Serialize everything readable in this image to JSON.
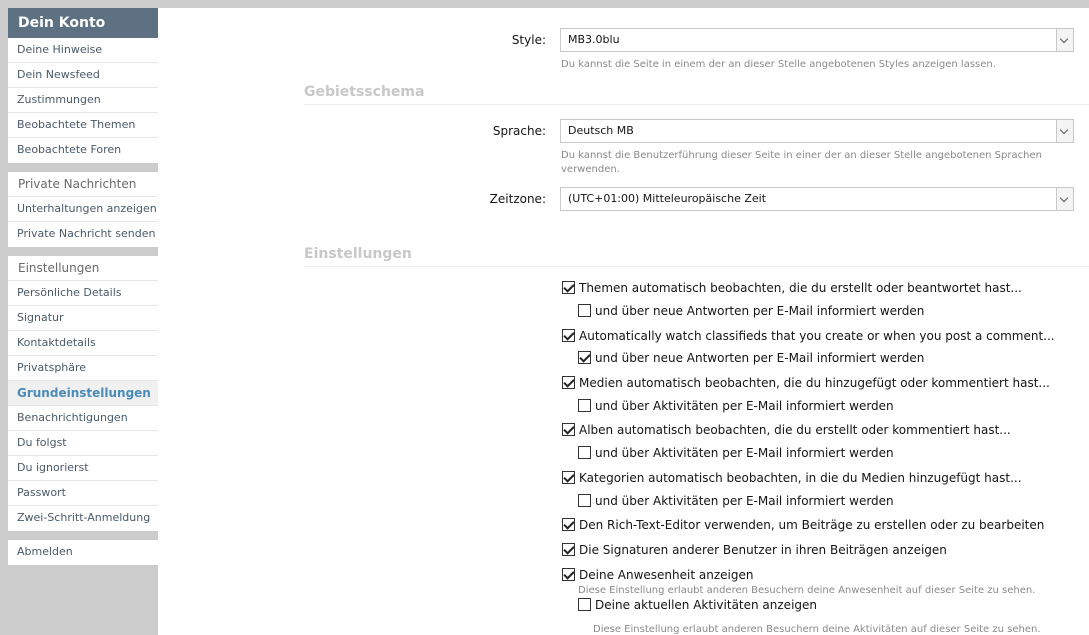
{
  "sidebar": {
    "title": "Dein Konto",
    "account_items": [
      "Deine Hinweise",
      "Dein Newsfeed",
      "Zustimmungen",
      "Beobachtete Themen",
      "Beobachtete Foren"
    ],
    "pm_section": "Private Nachrichten",
    "pm_items": [
      "Unterhaltungen anzeigen",
      "Private Nachricht senden"
    ],
    "settings_section": "Einstellungen",
    "settings_items": [
      "Persönliche Details",
      "Signatur",
      "Kontaktdetails",
      "Privatsphäre",
      "Grundeinstellungen",
      "Benachrichtigungen",
      "Du folgst",
      "Du ignorierst",
      "Passwort",
      "Zwei-Schritt-Anmeldung"
    ],
    "logout": "Abmelden"
  },
  "form": {
    "style": {
      "label": "Style:",
      "value": "MB3.0blu",
      "hint": "Du kannst die Seite in einem der an dieser Stelle angebotenen Styles anzeigen lassen."
    },
    "locale_heading": "Gebietsschema",
    "language": {
      "label": "Sprache:",
      "value": "Deutsch MB",
      "hint": "Du kannst die Benutzerführung dieser Seite in einer der an dieser Stelle angebotenen Sprachen verwenden."
    },
    "timezone": {
      "label": "Zeitzone:",
      "value": "(UTC+01:00) Mitteleuropäische Zeit"
    },
    "settings_heading": "Einstellungen",
    "options": [
      {
        "label": "Themen automatisch beobachten, die du erstellt oder beantwortet hast...",
        "checked": true
      },
      {
        "label": "und über neue Antworten per E-Mail informiert werden",
        "checked": false
      },
      {
        "label": "Automatically watch classifieds that you create or when you post a comment...",
        "checked": true
      },
      {
        "label": "und über neue Antworten per E-Mail informiert werden",
        "checked": true
      },
      {
        "label": "Medien automatisch beobachten, die du hinzugefügt oder kommentiert hast...",
        "checked": true
      },
      {
        "label": "und über Aktivitäten per E-Mail informiert werden",
        "checked": false
      },
      {
        "label": "Alben automatisch beobachten, die du erstellt oder kommentiert hast...",
        "checked": true
      },
      {
        "label": "und über Aktivitäten per E-Mail informiert werden",
        "checked": false
      },
      {
        "label": "Kategorien automatisch beobachten, in die du Medien hinzugefügt hast...",
        "checked": true
      },
      {
        "label": "und über Aktivitäten per E-Mail informiert werden",
        "checked": false
      },
      {
        "label": "Den Rich-Text-Editor verwenden, um Beiträge zu erstellen oder zu bearbeiten",
        "checked": true
      },
      {
        "label": "Die Signaturen anderer Benutzer in ihren Beiträgen anzeigen",
        "checked": true
      },
      {
        "label": "Deine Anwesenheit anzeigen",
        "checked": true,
        "hint": "Diese Einstellung erlaubt anderen Besuchern deine Anwesenheit auf dieser Seite zu sehen."
      },
      {
        "label": "Deine aktuellen Aktivitäten anzeigen",
        "checked": false,
        "hint": "Diese Einstellung erlaubt anderen Besuchern deine Aktivitäten auf dieser Seite zu sehen."
      }
    ]
  }
}
